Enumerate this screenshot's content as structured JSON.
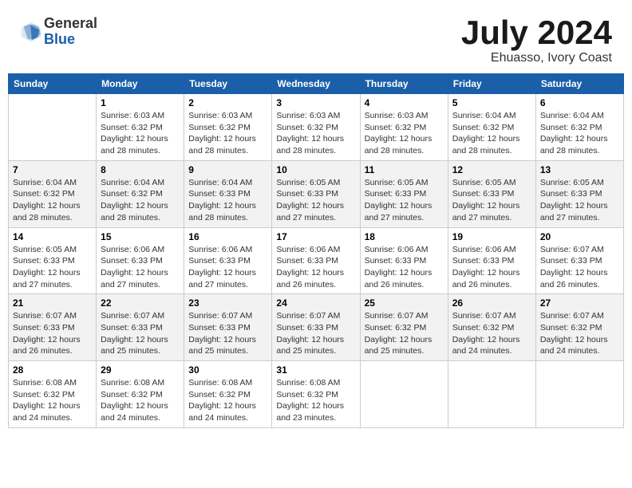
{
  "header": {
    "logo_general": "General",
    "logo_blue": "Blue",
    "month_title": "July 2024",
    "location": "Ehuasso, Ivory Coast"
  },
  "weekdays": [
    "Sunday",
    "Monday",
    "Tuesday",
    "Wednesday",
    "Thursday",
    "Friday",
    "Saturday"
  ],
  "weeks": [
    [
      {
        "day": "",
        "sunrise": "",
        "sunset": "",
        "daylight": ""
      },
      {
        "day": "1",
        "sunrise": "Sunrise: 6:03 AM",
        "sunset": "Sunset: 6:32 PM",
        "daylight": "Daylight: 12 hours and 28 minutes."
      },
      {
        "day": "2",
        "sunrise": "Sunrise: 6:03 AM",
        "sunset": "Sunset: 6:32 PM",
        "daylight": "Daylight: 12 hours and 28 minutes."
      },
      {
        "day": "3",
        "sunrise": "Sunrise: 6:03 AM",
        "sunset": "Sunset: 6:32 PM",
        "daylight": "Daylight: 12 hours and 28 minutes."
      },
      {
        "day": "4",
        "sunrise": "Sunrise: 6:03 AM",
        "sunset": "Sunset: 6:32 PM",
        "daylight": "Daylight: 12 hours and 28 minutes."
      },
      {
        "day": "5",
        "sunrise": "Sunrise: 6:04 AM",
        "sunset": "Sunset: 6:32 PM",
        "daylight": "Daylight: 12 hours and 28 minutes."
      },
      {
        "day": "6",
        "sunrise": "Sunrise: 6:04 AM",
        "sunset": "Sunset: 6:32 PM",
        "daylight": "Daylight: 12 hours and 28 minutes."
      }
    ],
    [
      {
        "day": "7",
        "sunrise": "Sunrise: 6:04 AM",
        "sunset": "Sunset: 6:32 PM",
        "daylight": "Daylight: 12 hours and 28 minutes."
      },
      {
        "day": "8",
        "sunrise": "Sunrise: 6:04 AM",
        "sunset": "Sunset: 6:32 PM",
        "daylight": "Daylight: 12 hours and 28 minutes."
      },
      {
        "day": "9",
        "sunrise": "Sunrise: 6:04 AM",
        "sunset": "Sunset: 6:33 PM",
        "daylight": "Daylight: 12 hours and 28 minutes."
      },
      {
        "day": "10",
        "sunrise": "Sunrise: 6:05 AM",
        "sunset": "Sunset: 6:33 PM",
        "daylight": "Daylight: 12 hours and 27 minutes."
      },
      {
        "day": "11",
        "sunrise": "Sunrise: 6:05 AM",
        "sunset": "Sunset: 6:33 PM",
        "daylight": "Daylight: 12 hours and 27 minutes."
      },
      {
        "day": "12",
        "sunrise": "Sunrise: 6:05 AM",
        "sunset": "Sunset: 6:33 PM",
        "daylight": "Daylight: 12 hours and 27 minutes."
      },
      {
        "day": "13",
        "sunrise": "Sunrise: 6:05 AM",
        "sunset": "Sunset: 6:33 PM",
        "daylight": "Daylight: 12 hours and 27 minutes."
      }
    ],
    [
      {
        "day": "14",
        "sunrise": "Sunrise: 6:05 AM",
        "sunset": "Sunset: 6:33 PM",
        "daylight": "Daylight: 12 hours and 27 minutes."
      },
      {
        "day": "15",
        "sunrise": "Sunrise: 6:06 AM",
        "sunset": "Sunset: 6:33 PM",
        "daylight": "Daylight: 12 hours and 27 minutes."
      },
      {
        "day": "16",
        "sunrise": "Sunrise: 6:06 AM",
        "sunset": "Sunset: 6:33 PM",
        "daylight": "Daylight: 12 hours and 27 minutes."
      },
      {
        "day": "17",
        "sunrise": "Sunrise: 6:06 AM",
        "sunset": "Sunset: 6:33 PM",
        "daylight": "Daylight: 12 hours and 26 minutes."
      },
      {
        "day": "18",
        "sunrise": "Sunrise: 6:06 AM",
        "sunset": "Sunset: 6:33 PM",
        "daylight": "Daylight: 12 hours and 26 minutes."
      },
      {
        "day": "19",
        "sunrise": "Sunrise: 6:06 AM",
        "sunset": "Sunset: 6:33 PM",
        "daylight": "Daylight: 12 hours and 26 minutes."
      },
      {
        "day": "20",
        "sunrise": "Sunrise: 6:07 AM",
        "sunset": "Sunset: 6:33 PM",
        "daylight": "Daylight: 12 hours and 26 minutes."
      }
    ],
    [
      {
        "day": "21",
        "sunrise": "Sunrise: 6:07 AM",
        "sunset": "Sunset: 6:33 PM",
        "daylight": "Daylight: 12 hours and 26 minutes."
      },
      {
        "day": "22",
        "sunrise": "Sunrise: 6:07 AM",
        "sunset": "Sunset: 6:33 PM",
        "daylight": "Daylight: 12 hours and 25 minutes."
      },
      {
        "day": "23",
        "sunrise": "Sunrise: 6:07 AM",
        "sunset": "Sunset: 6:33 PM",
        "daylight": "Daylight: 12 hours and 25 minutes."
      },
      {
        "day": "24",
        "sunrise": "Sunrise: 6:07 AM",
        "sunset": "Sunset: 6:33 PM",
        "daylight": "Daylight: 12 hours and 25 minutes."
      },
      {
        "day": "25",
        "sunrise": "Sunrise: 6:07 AM",
        "sunset": "Sunset: 6:32 PM",
        "daylight": "Daylight: 12 hours and 25 minutes."
      },
      {
        "day": "26",
        "sunrise": "Sunrise: 6:07 AM",
        "sunset": "Sunset: 6:32 PM",
        "daylight": "Daylight: 12 hours and 24 minutes."
      },
      {
        "day": "27",
        "sunrise": "Sunrise: 6:07 AM",
        "sunset": "Sunset: 6:32 PM",
        "daylight": "Daylight: 12 hours and 24 minutes."
      }
    ],
    [
      {
        "day": "28",
        "sunrise": "Sunrise: 6:08 AM",
        "sunset": "Sunset: 6:32 PM",
        "daylight": "Daylight: 12 hours and 24 minutes."
      },
      {
        "day": "29",
        "sunrise": "Sunrise: 6:08 AM",
        "sunset": "Sunset: 6:32 PM",
        "daylight": "Daylight: 12 hours and 24 minutes."
      },
      {
        "day": "30",
        "sunrise": "Sunrise: 6:08 AM",
        "sunset": "Sunset: 6:32 PM",
        "daylight": "Daylight: 12 hours and 24 minutes."
      },
      {
        "day": "31",
        "sunrise": "Sunrise: 6:08 AM",
        "sunset": "Sunset: 6:32 PM",
        "daylight": "Daylight: 12 hours and 23 minutes."
      },
      {
        "day": "",
        "sunrise": "",
        "sunset": "",
        "daylight": ""
      },
      {
        "day": "",
        "sunrise": "",
        "sunset": "",
        "daylight": ""
      },
      {
        "day": "",
        "sunrise": "",
        "sunset": "",
        "daylight": ""
      }
    ]
  ]
}
